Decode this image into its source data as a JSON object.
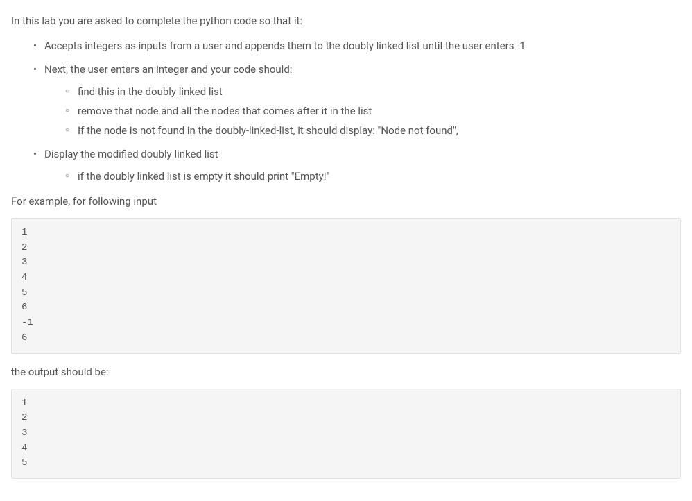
{
  "intro": "In this lab you are asked to complete the python code so that it:",
  "bullets": {
    "b1": "Accepts integers as inputs from a user and appends them to the doubly linked list until the user enters -1",
    "b2": "Next, the user enters an integer and your code should:",
    "b2_sub": {
      "s1": "find this in the doubly linked list",
      "s2": "remove that node and all the nodes that comes after it in the list",
      "s3": "If the node is not found in the doubly-linked-list, it should display: \"Node not found\","
    },
    "b3": "Display the modified doubly linked list",
    "b3_sub": {
      "s1": "if the doubly linked list is empty it should print \"Empty!\""
    }
  },
  "example_intro": "For example, for following input",
  "example_input": "1\n2\n3\n4\n5\n6\n-1\n6",
  "output_intro": "the output should be:",
  "example_output": "1\n2\n3\n4\n5"
}
